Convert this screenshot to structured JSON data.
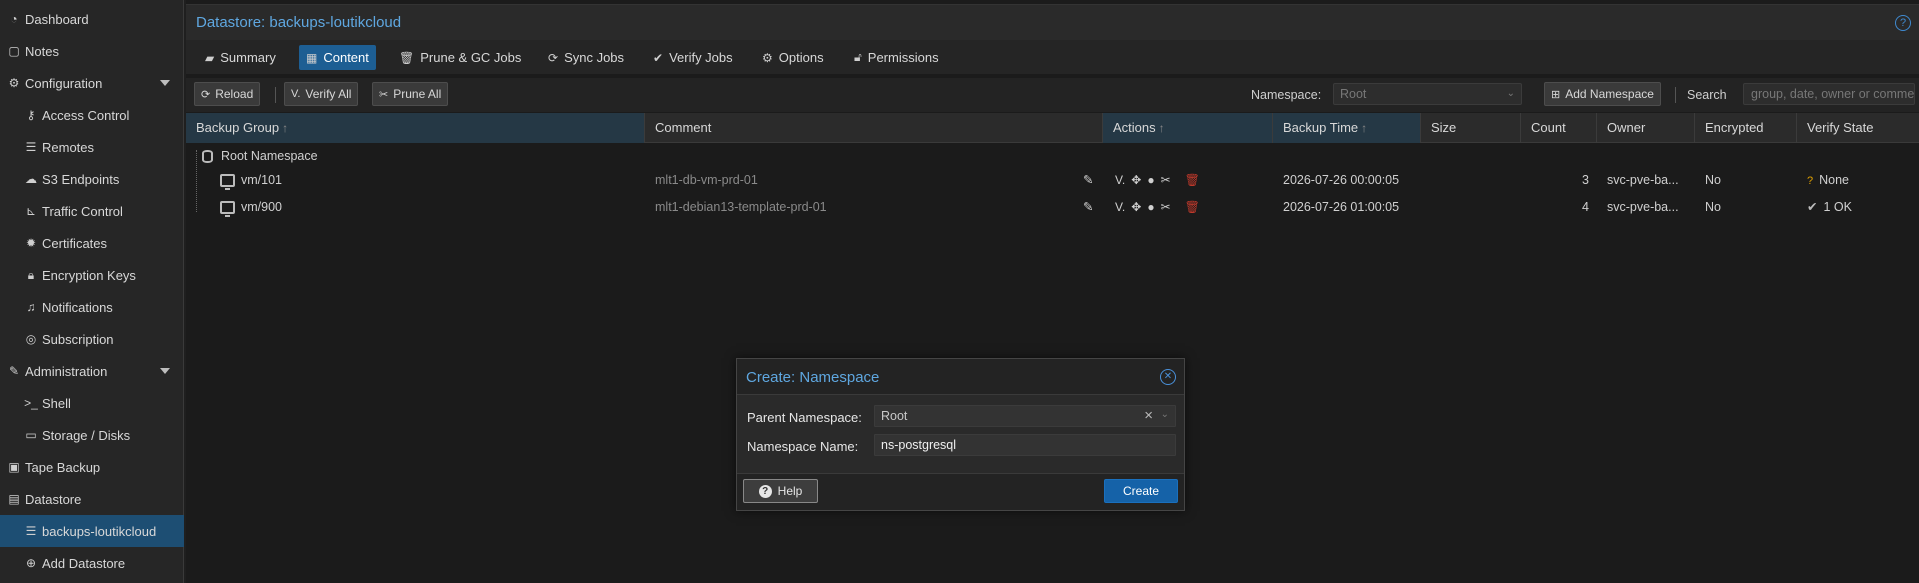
{
  "sidebar": {
    "items": [
      {
        "label": "Dashboard",
        "icon": "dashboard-icon"
      },
      {
        "label": "Notes",
        "icon": "notes-icon"
      },
      {
        "label": "Configuration",
        "icon": "gears-icon"
      },
      {
        "label": "Access Control",
        "icon": "key-icon"
      },
      {
        "label": "Remotes",
        "icon": "server-icon"
      },
      {
        "label": "S3 Endpoints",
        "icon": "cloud-upload-icon"
      },
      {
        "label": "Traffic Control",
        "icon": "chart-icon"
      },
      {
        "label": "Certificates",
        "icon": "certificate-icon"
      },
      {
        "label": "Encryption Keys",
        "icon": "lock-icon"
      },
      {
        "label": "Notifications",
        "icon": "bell-icon"
      },
      {
        "label": "Subscription",
        "icon": "support-icon"
      },
      {
        "label": "Administration",
        "icon": "wrench-icon"
      },
      {
        "label": "Shell",
        "icon": "terminal-icon"
      },
      {
        "label": "Storage / Disks",
        "icon": "hdd-icon"
      },
      {
        "label": "Tape Backup",
        "icon": "tape-icon"
      },
      {
        "label": "Datastore",
        "icon": "archive-icon"
      },
      {
        "label": "backups-loutikcloud",
        "icon": "database-icon"
      },
      {
        "label": "Add Datastore",
        "icon": "plus-circle-icon"
      }
    ]
  },
  "header": {
    "title": "Datastore: backups-loutikcloud",
    "help": "?"
  },
  "tabs": [
    {
      "label": "Summary",
      "icon": "book-icon"
    },
    {
      "label": "Content",
      "icon": "grid-icon"
    },
    {
      "label": "Prune & GC Jobs",
      "icon": "trash-icon"
    },
    {
      "label": "Sync Jobs",
      "icon": "refresh-icon"
    },
    {
      "label": "Verify Jobs",
      "icon": "check-circle-icon"
    },
    {
      "label": "Options",
      "icon": "gear-icon"
    },
    {
      "label": "Permissions",
      "icon": "unlock-icon"
    }
  ],
  "toolbar": {
    "reload": "Reload",
    "verify_all": "Verify All",
    "prune_all": "Prune All",
    "namespace_label": "Namespace:",
    "namespace_value": "Root",
    "add_namespace": "Add Namespace",
    "search_label": "Search",
    "search_placeholder": "group, date, owner or comment"
  },
  "grid": {
    "columns": [
      "Backup Group",
      "Comment",
      "Actions",
      "Backup Time",
      "Size",
      "Count",
      "Owner",
      "Encrypted",
      "Verify State"
    ],
    "root": "Root Namespace",
    "rows": [
      {
        "group": "vm/101",
        "comment": "mlt1-db-vm-prd-01",
        "time": "2026-07-26 00:00:05",
        "size": "",
        "count": "3",
        "owner": "svc-pve-ba...",
        "encrypted": "No",
        "verify": "None",
        "verify_icon": "question-icon"
      },
      {
        "group": "vm/900",
        "comment": "mlt1-debian13-template-prd-01",
        "time": "2026-07-26 01:00:05",
        "size": "",
        "count": "4",
        "owner": "svc-pve-ba...",
        "encrypted": "No",
        "verify": "1 OK",
        "verify_icon": "check-icon"
      }
    ]
  },
  "dialog": {
    "title": "Create: Namespace",
    "parent_label": "Parent Namespace:",
    "parent_value": "Root",
    "name_label": "Namespace Name:",
    "name_value": "ns-postgresql",
    "help": "Help",
    "create": "Create"
  },
  "colors": {
    "accent": "#5fa7e0",
    "selected": "#1d4e73",
    "primary_button": "#1562a8",
    "danger": "#c0392b",
    "warning": "#e0a000"
  }
}
